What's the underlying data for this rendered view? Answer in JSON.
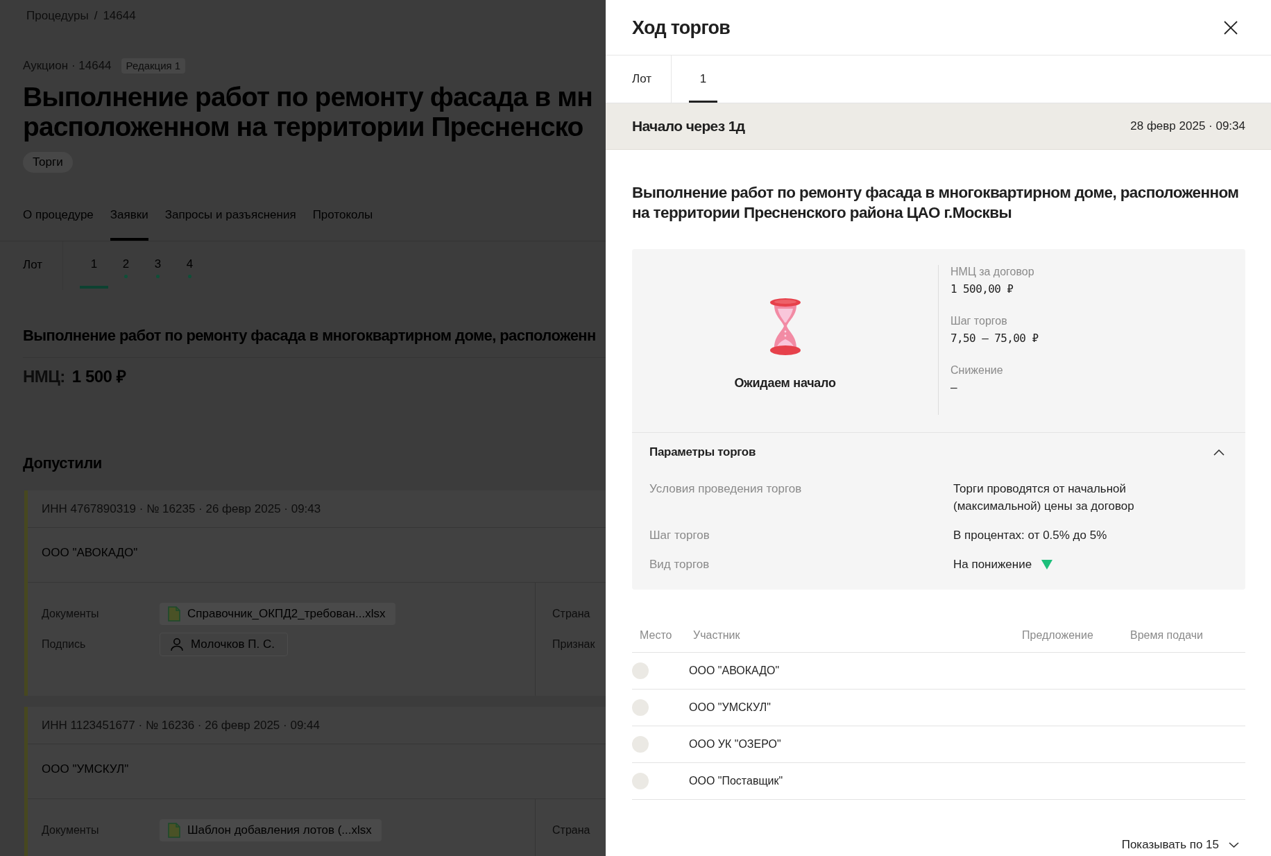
{
  "background_page": {
    "breadcrumbs": [
      "Процедуры",
      "14644"
    ],
    "breadcrumb_separator": "/",
    "procedure": "Аукцион · 14644",
    "revision": "Редакция 1",
    "title_lines": [
      "Выполнение работ по ремонту фасада в мн",
      "расположенном на территории Пресненско"
    ],
    "tag": "Торги",
    "tabs": [
      {
        "label": "О процедуре",
        "selected": false
      },
      {
        "label": "Заявки",
        "selected": true
      },
      {
        "label": "Запросы и разъяснения",
        "selected": false
      },
      {
        "label": "Протоколы",
        "selected": false
      }
    ],
    "lot_label": "Лот",
    "lots": [
      {
        "label": "1",
        "selected": true,
        "marked": false
      },
      {
        "label": "2",
        "selected": false,
        "marked": true
      },
      {
        "label": "3",
        "selected": false,
        "marked": true
      },
      {
        "label": "4",
        "selected": false,
        "marked": true
      }
    ],
    "lot_title": "Выполнение работ по ремонту фасада в многоквартирном доме, расположенн",
    "nmc_label": "НМЦ:",
    "nmc_value": "1 500 ₽",
    "section_title": "Допустили",
    "applications": [
      {
        "header": "ИНН 4767890319 · № 16235 · 26 февр 2025 · 09:43",
        "company": "ООО \"АВОКАДО\"",
        "fields": [
          {
            "label": "Документы",
            "kind": "file",
            "value": "Справочник_ОКПД2_требован...xlsx"
          },
          {
            "label": "Подпись",
            "kind": "person",
            "value": "Молочков П. С."
          }
        ],
        "side_labels": [
          "Страна",
          "Признак"
        ]
      },
      {
        "header": "ИНН 1123451677 · № 16236 · 26 февр 2025 · 09:44",
        "company": "ООО \"УМСКУЛ\"",
        "fields": [
          {
            "label": "Документы",
            "kind": "file",
            "value": "Шаблон добавления лотов (...xlsx"
          }
        ],
        "side_labels": [
          "Страна"
        ]
      }
    ]
  },
  "drawer": {
    "title": "Ход торгов",
    "lot_label": "Лот",
    "lots": [
      {
        "label": "1",
        "selected": true
      }
    ],
    "status": "Начало через 1д",
    "start_time": "28 февр 2025 · 09:34",
    "lot_title": "Выполнение работ по ремонту фасада в многоквартирном доме, расположенном на территории Пресненского района ЦАО г.Москвы",
    "state": "Ожидаем начало",
    "summary": [
      {
        "label": "НМЦ за договор",
        "value": "1 500,00 ₽"
      },
      {
        "label": "Шаг торгов",
        "value": "7,50 – 75,00 ₽"
      },
      {
        "label": "Снижение",
        "value": "—"
      }
    ],
    "parameters": {
      "title": "Параметры торгов",
      "expanded": true,
      "rows": [
        {
          "kind": "plain",
          "label": "Условия проведения торгов",
          "value": "Торги проводятся от начальной (максимальной) цены за договор"
        },
        {
          "kind": "plain",
          "label": "Шаг торгов",
          "value": "В процентах: от 0.5% до 5%"
        },
        {
          "kind": "decrease",
          "label": "Вид торгов",
          "value": "На понижение"
        }
      ]
    },
    "table": {
      "columns": [
        "Место",
        "Участник",
        "Предложение",
        "Время подачи"
      ],
      "rows": [
        {
          "participant": "ООО \"АВОКАДО\""
        },
        {
          "participant": "ООО \"УМСКУЛ\""
        },
        {
          "participant": "ООО УК \"ОЗЕРО\""
        },
        {
          "participant": "ООО \"Поставщик\""
        }
      ]
    },
    "page_size": "Показывать по 15"
  }
}
